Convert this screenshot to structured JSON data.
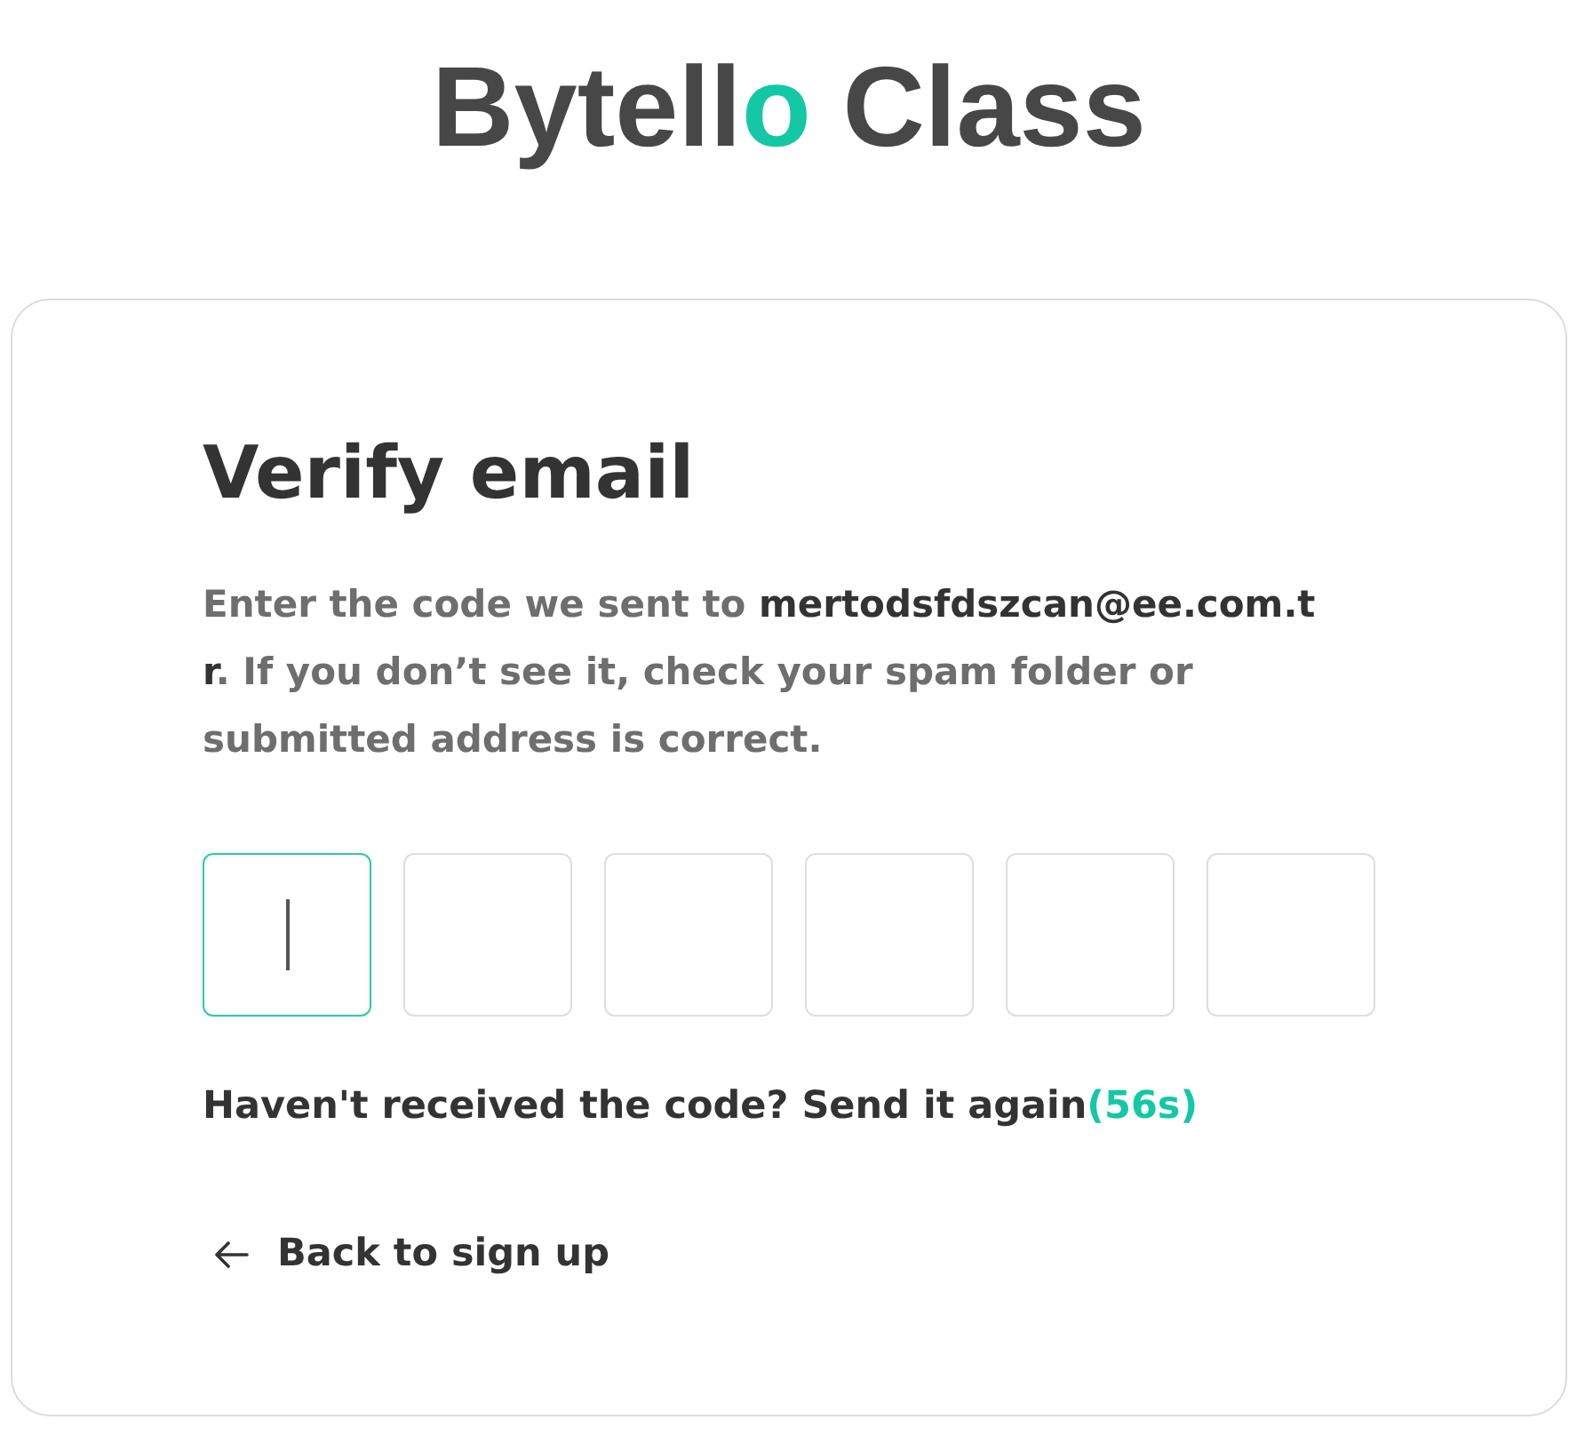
{
  "logo": {
    "segments": [
      {
        "text": "Bytell",
        "accent": false
      },
      {
        "text": "o",
        "accent": true
      },
      {
        "text": " Class",
        "accent": false
      }
    ]
  },
  "card": {
    "title": "Verify email",
    "instructions": {
      "before": "Enter the code we sent to ",
      "email": "mertodsfdszcan@ee.com.tr",
      "after": ". If you don’t see it, check your spam folder or submitted address is correct."
    },
    "code_boxes": [
      {
        "focused": true
      },
      {
        "focused": false
      },
      {
        "focused": false
      },
      {
        "focused": false
      },
      {
        "focused": false
      },
      {
        "focused": false
      }
    ],
    "resend": {
      "prompt": "Haven't received the code? Send it again",
      "countdown": "(56s)"
    },
    "back_link": {
      "label": "Back to sign up"
    }
  }
}
